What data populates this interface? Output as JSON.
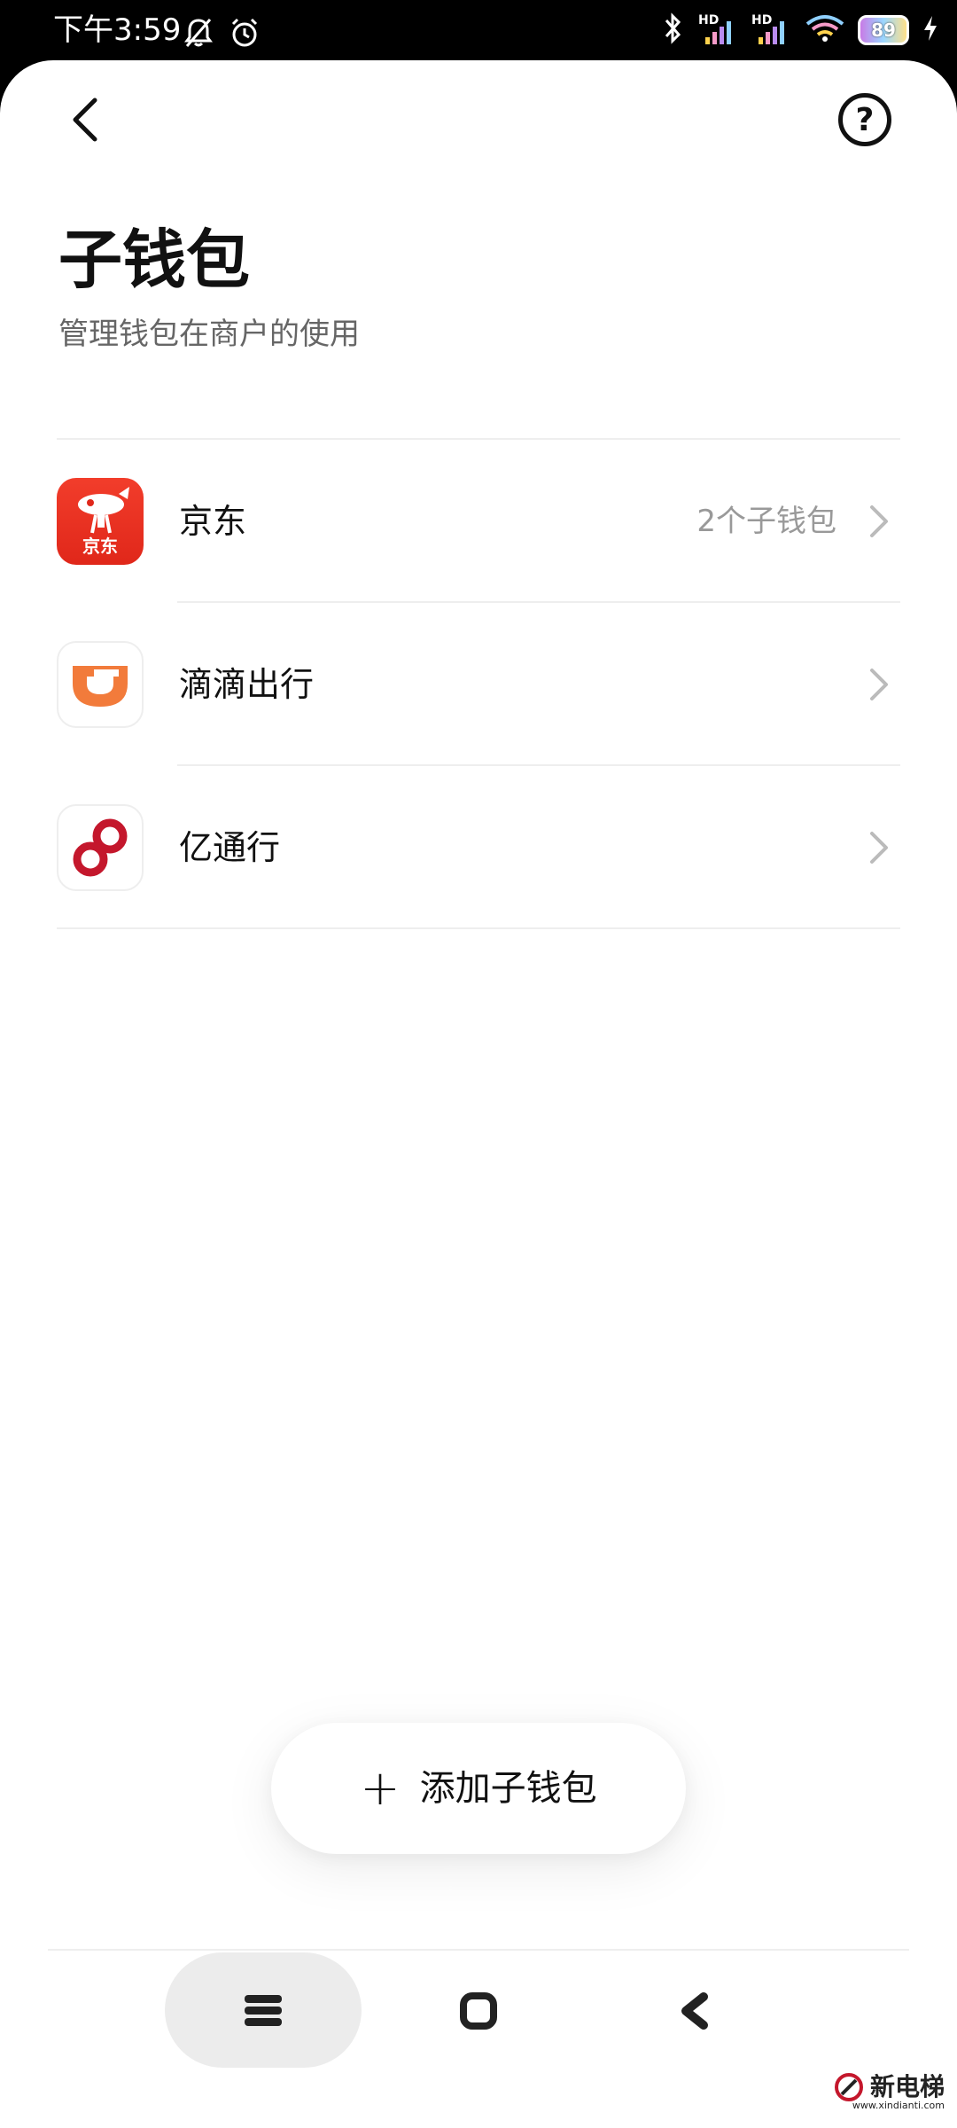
{
  "status_bar": {
    "time": "下午3:59",
    "hd_label_1": "HD",
    "hd_label_2": "HD",
    "battery": "89"
  },
  "header": {
    "title": "子钱包",
    "subtitle": "管理钱包在商户的使用"
  },
  "help": {
    "label": "?"
  },
  "merchants": [
    {
      "name": "京东",
      "meta": "2个子钱包",
      "icon": "jd-app-icon",
      "icon_text": "京东"
    },
    {
      "name": "滴滴出行",
      "meta": "",
      "icon": "didi-app-icon"
    },
    {
      "name": "亿通行",
      "meta": "",
      "icon": "yitongxing-app-icon"
    }
  ],
  "add_button": {
    "plus": "+",
    "label": "添加子钱包"
  },
  "watermark": {
    "text": "新电梯",
    "sub": "www.xindianti.com"
  },
  "colors": {
    "jd_red": "#e6281b",
    "didi_orange": "#f27b3b",
    "yitongxing_red": "#c4172c"
  }
}
